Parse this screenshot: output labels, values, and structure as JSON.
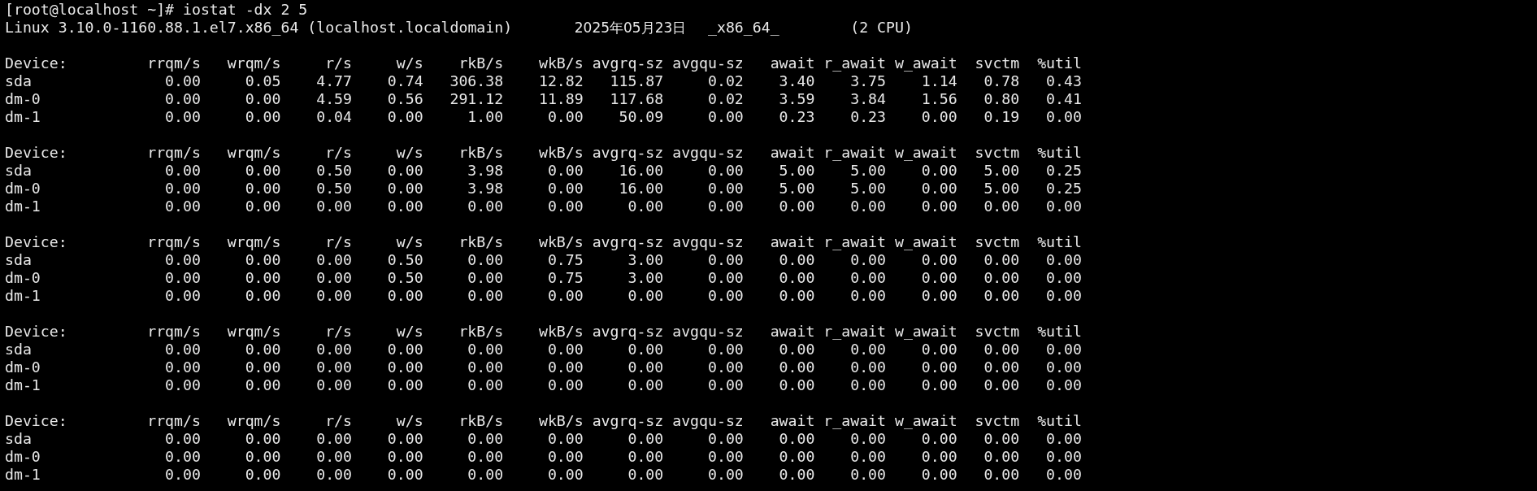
{
  "command_line": "[root@localhost ~]# iostat -dx 2 5",
  "system_info": {
    "kernel": "Linux 3.10.0-1160.88.1.el7.x86_64 (localhost.localdomain)",
    "date": "2025年05月23日",
    "arch": "_x86_64_",
    "cpus": "(2 CPU)"
  },
  "reports": [
    {
      "columns": [
        "Device:",
        "rrqm/s",
        "wrqm/s",
        "r/s",
        "w/s",
        "rkB/s",
        "wkB/s",
        "avgrq-sz",
        "avgqu-sz",
        "await",
        "r_await",
        "w_await",
        "svctm",
        "%util"
      ],
      "rows": [
        {
          "device": "sda",
          "values": [
            "0.00",
            "0.05",
            "4.77",
            "0.74",
            "306.38",
            "12.82",
            "115.87",
            "0.02",
            "3.40",
            "3.75",
            "1.14",
            "0.78",
            "0.43"
          ]
        },
        {
          "device": "dm-0",
          "values": [
            "0.00",
            "0.00",
            "4.59",
            "0.56",
            "291.12",
            "11.89",
            "117.68",
            "0.02",
            "3.59",
            "3.84",
            "1.56",
            "0.80",
            "0.41"
          ]
        },
        {
          "device": "dm-1",
          "values": [
            "0.00",
            "0.00",
            "0.04",
            "0.00",
            "1.00",
            "0.00",
            "50.09",
            "0.00",
            "0.23",
            "0.23",
            "0.00",
            "0.19",
            "0.00"
          ]
        }
      ]
    },
    {
      "columns": [
        "Device:",
        "rrqm/s",
        "wrqm/s",
        "r/s",
        "w/s",
        "rkB/s",
        "wkB/s",
        "avgrq-sz",
        "avgqu-sz",
        "await",
        "r_await",
        "w_await",
        "svctm",
        "%util"
      ],
      "rows": [
        {
          "device": "sda",
          "values": [
            "0.00",
            "0.00",
            "0.50",
            "0.00",
            "3.98",
            "0.00",
            "16.00",
            "0.00",
            "5.00",
            "5.00",
            "0.00",
            "5.00",
            "0.25"
          ]
        },
        {
          "device": "dm-0",
          "values": [
            "0.00",
            "0.00",
            "0.50",
            "0.00",
            "3.98",
            "0.00",
            "16.00",
            "0.00",
            "5.00",
            "5.00",
            "0.00",
            "5.00",
            "0.25"
          ]
        },
        {
          "device": "dm-1",
          "values": [
            "0.00",
            "0.00",
            "0.00",
            "0.00",
            "0.00",
            "0.00",
            "0.00",
            "0.00",
            "0.00",
            "0.00",
            "0.00",
            "0.00",
            "0.00"
          ]
        }
      ]
    },
    {
      "columns": [
        "Device:",
        "rrqm/s",
        "wrqm/s",
        "r/s",
        "w/s",
        "rkB/s",
        "wkB/s",
        "avgrq-sz",
        "avgqu-sz",
        "await",
        "r_await",
        "w_await",
        "svctm",
        "%util"
      ],
      "rows": [
        {
          "device": "sda",
          "values": [
            "0.00",
            "0.00",
            "0.00",
            "0.50",
            "0.00",
            "0.75",
            "3.00",
            "0.00",
            "0.00",
            "0.00",
            "0.00",
            "0.00",
            "0.00"
          ]
        },
        {
          "device": "dm-0",
          "values": [
            "0.00",
            "0.00",
            "0.00",
            "0.50",
            "0.00",
            "0.75",
            "3.00",
            "0.00",
            "0.00",
            "0.00",
            "0.00",
            "0.00",
            "0.00"
          ]
        },
        {
          "device": "dm-1",
          "values": [
            "0.00",
            "0.00",
            "0.00",
            "0.00",
            "0.00",
            "0.00",
            "0.00",
            "0.00",
            "0.00",
            "0.00",
            "0.00",
            "0.00",
            "0.00"
          ]
        }
      ]
    },
    {
      "columns": [
        "Device:",
        "rrqm/s",
        "wrqm/s",
        "r/s",
        "w/s",
        "rkB/s",
        "wkB/s",
        "avgrq-sz",
        "avgqu-sz",
        "await",
        "r_await",
        "w_await",
        "svctm",
        "%util"
      ],
      "rows": [
        {
          "device": "sda",
          "values": [
            "0.00",
            "0.00",
            "0.00",
            "0.00",
            "0.00",
            "0.00",
            "0.00",
            "0.00",
            "0.00",
            "0.00",
            "0.00",
            "0.00",
            "0.00"
          ]
        },
        {
          "device": "dm-0",
          "values": [
            "0.00",
            "0.00",
            "0.00",
            "0.00",
            "0.00",
            "0.00",
            "0.00",
            "0.00",
            "0.00",
            "0.00",
            "0.00",
            "0.00",
            "0.00"
          ]
        },
        {
          "device": "dm-1",
          "values": [
            "0.00",
            "0.00",
            "0.00",
            "0.00",
            "0.00",
            "0.00",
            "0.00",
            "0.00",
            "0.00",
            "0.00",
            "0.00",
            "0.00",
            "0.00"
          ]
        }
      ]
    },
    {
      "columns": [
        "Device:",
        "rrqm/s",
        "wrqm/s",
        "r/s",
        "w/s",
        "rkB/s",
        "wkB/s",
        "avgrq-sz",
        "avgqu-sz",
        "await",
        "r_await",
        "w_await",
        "svctm",
        "%util"
      ],
      "rows": [
        {
          "device": "sda",
          "values": [
            "0.00",
            "0.00",
            "0.00",
            "0.00",
            "0.00",
            "0.00",
            "0.00",
            "0.00",
            "0.00",
            "0.00",
            "0.00",
            "0.00",
            "0.00"
          ]
        },
        {
          "device": "dm-0",
          "values": [
            "0.00",
            "0.00",
            "0.00",
            "0.00",
            "0.00",
            "0.00",
            "0.00",
            "0.00",
            "0.00",
            "0.00",
            "0.00",
            "0.00",
            "0.00"
          ]
        },
        {
          "device": "dm-1",
          "values": [
            "0.00",
            "0.00",
            "0.00",
            "0.00",
            "0.00",
            "0.00",
            "0.00",
            "0.00",
            "0.00",
            "0.00",
            "0.00",
            "0.00",
            "0.00"
          ]
        }
      ]
    }
  ]
}
